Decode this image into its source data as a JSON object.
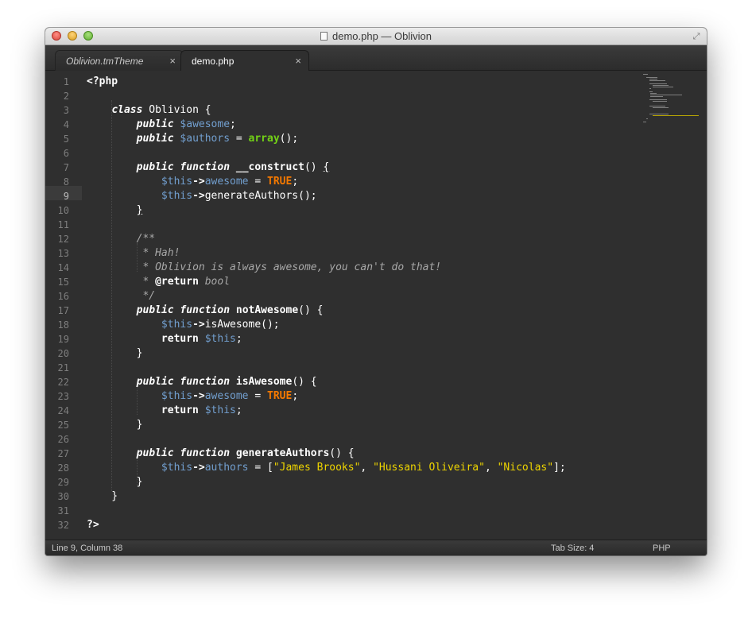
{
  "window": {
    "title": "demo.php — Oblivion"
  },
  "tabs": [
    {
      "label": "Oblivion.tmTheme",
      "close": "×"
    },
    {
      "label": "demo.php",
      "close": "×"
    }
  ],
  "editor": {
    "current_line": 9,
    "line_numbers": [
      "1",
      "2",
      "3",
      "4",
      "5",
      "6",
      "7",
      "8",
      "9",
      "10",
      "11",
      "12",
      "13",
      "14",
      "15",
      "16",
      "17",
      "18",
      "19",
      "20",
      "21",
      "22",
      "23",
      "24",
      "25",
      "26",
      "27",
      "28",
      "29",
      "30",
      "31",
      "32"
    ],
    "lines": [
      [
        {
          "t": "<?php",
          "c": "bold"
        }
      ],
      [],
      [
        {
          "t": "    "
        },
        {
          "t": "class",
          "c": "kw"
        },
        {
          "t": " Oblivion {"
        }
      ],
      [
        {
          "t": "        "
        },
        {
          "t": "public",
          "c": "kw"
        },
        {
          "t": " "
        },
        {
          "t": "$awesome",
          "c": "var"
        },
        {
          "t": ";"
        }
      ],
      [
        {
          "t": "        "
        },
        {
          "t": "public",
          "c": "kw"
        },
        {
          "t": " "
        },
        {
          "t": "$authors",
          "c": "var"
        },
        {
          "t": " = "
        },
        {
          "t": "array",
          "c": "fnc"
        },
        {
          "t": "();"
        }
      ],
      [],
      [
        {
          "t": "        "
        },
        {
          "t": "public",
          "c": "kw"
        },
        {
          "t": " "
        },
        {
          "t": "function",
          "c": "kw"
        },
        {
          "t": " "
        },
        {
          "t": "__construct",
          "c": "bold"
        },
        {
          "t": "() "
        },
        {
          "t": "{",
          "c": "brace-hl"
        }
      ],
      [
        {
          "t": "            "
        },
        {
          "t": "$this",
          "c": "var"
        },
        {
          "t": "->",
          "c": "bold"
        },
        {
          "t": "awesome",
          "c": "var"
        },
        {
          "t": " = "
        },
        {
          "t": "TRUE",
          "c": "cst"
        },
        {
          "t": ";"
        }
      ],
      [
        {
          "t": "            "
        },
        {
          "t": "$this",
          "c": "var"
        },
        {
          "t": "->",
          "c": "bold"
        },
        {
          "t": "generateAuthors();"
        }
      ],
      [
        {
          "t": "        "
        },
        {
          "t": "}",
          "c": "brace-hl"
        }
      ],
      [],
      [
        {
          "t": "        "
        },
        {
          "t": "/**",
          "c": "cmt"
        }
      ],
      [
        {
          "t": "         "
        },
        {
          "t": "* Hah!",
          "c": "cmt"
        }
      ],
      [
        {
          "t": "         "
        },
        {
          "t": "* Oblivion is always awesome, you can't do that!",
          "c": "cmt"
        }
      ],
      [
        {
          "t": "         "
        },
        {
          "t": "* ",
          "c": "cmt"
        },
        {
          "t": "@return",
          "c": "cmtb"
        },
        {
          "t": " bool",
          "c": "cmt"
        }
      ],
      [
        {
          "t": "         "
        },
        {
          "t": "*/",
          "c": "cmt"
        }
      ],
      [
        {
          "t": "        "
        },
        {
          "t": "public",
          "c": "kw"
        },
        {
          "t": " "
        },
        {
          "t": "function",
          "c": "kw"
        },
        {
          "t": " "
        },
        {
          "t": "notAwesome",
          "c": "bold"
        },
        {
          "t": "() {"
        }
      ],
      [
        {
          "t": "            "
        },
        {
          "t": "$this",
          "c": "var"
        },
        {
          "t": "->",
          "c": "bold"
        },
        {
          "t": "isAwesome();"
        }
      ],
      [
        {
          "t": "            "
        },
        {
          "t": "return",
          "c": "bold"
        },
        {
          "t": " "
        },
        {
          "t": "$this",
          "c": "var"
        },
        {
          "t": ";"
        }
      ],
      [
        {
          "t": "        }"
        }
      ],
      [],
      [
        {
          "t": "        "
        },
        {
          "t": "public",
          "c": "kw"
        },
        {
          "t": " "
        },
        {
          "t": "function",
          "c": "kw"
        },
        {
          "t": " "
        },
        {
          "t": "isAwesome",
          "c": "bold"
        },
        {
          "t": "() {"
        }
      ],
      [
        {
          "t": "            "
        },
        {
          "t": "$this",
          "c": "var"
        },
        {
          "t": "->",
          "c": "bold"
        },
        {
          "t": "awesome",
          "c": "var"
        },
        {
          "t": " = "
        },
        {
          "t": "TRUE",
          "c": "cst"
        },
        {
          "t": ";"
        }
      ],
      [
        {
          "t": "            "
        },
        {
          "t": "return",
          "c": "bold"
        },
        {
          "t": " "
        },
        {
          "t": "$this",
          "c": "var"
        },
        {
          "t": ";"
        }
      ],
      [
        {
          "t": "        }"
        }
      ],
      [],
      [
        {
          "t": "        "
        },
        {
          "t": "public",
          "c": "kw"
        },
        {
          "t": " "
        },
        {
          "t": "function",
          "c": "kw"
        },
        {
          "t": " "
        },
        {
          "t": "generateAuthors",
          "c": "bold"
        },
        {
          "t": "() {"
        }
      ],
      [
        {
          "t": "            "
        },
        {
          "t": "$this",
          "c": "var"
        },
        {
          "t": "->",
          "c": "bold"
        },
        {
          "t": "authors",
          "c": "var"
        },
        {
          "t": " = ["
        },
        {
          "t": "\"James Brooks\"",
          "c": "str"
        },
        {
          "t": ", "
        },
        {
          "t": "\"Hussani Oliveira\"",
          "c": "str"
        },
        {
          "t": ", "
        },
        {
          "t": "\"Nicolas\"",
          "c": "str"
        },
        {
          "t": "];"
        }
      ],
      [
        {
          "t": "        }"
        }
      ],
      [
        {
          "t": "    }"
        }
      ],
      [],
      [
        {
          "t": "?>",
          "c": "bold"
        }
      ]
    ]
  },
  "status": {
    "position": "Line 9, Column 38",
    "tab_size": "Tab Size: 4",
    "syntax": "PHP"
  },
  "colors": {
    "background": "#2f2f2f",
    "variable": "#729fcf",
    "string": "#edd400",
    "constant": "#f57900",
    "builtin": "#73d216",
    "comment": "#a8a8a8"
  }
}
